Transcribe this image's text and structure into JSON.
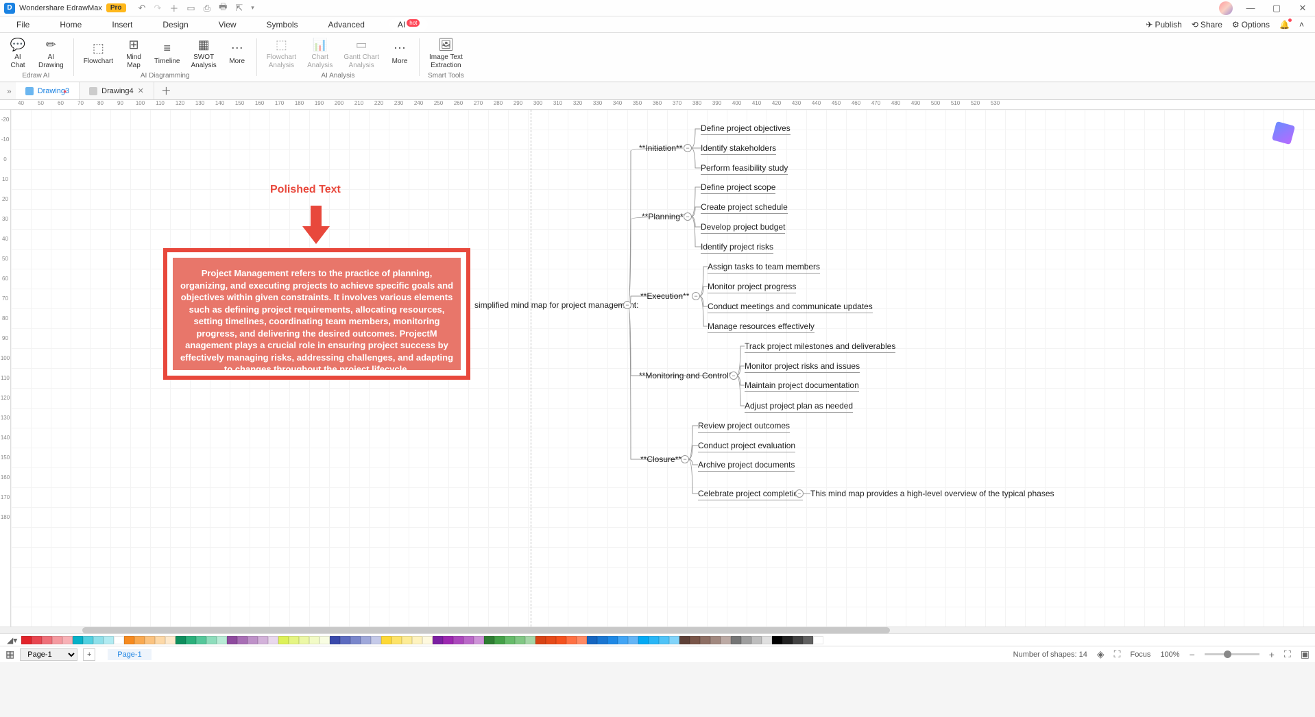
{
  "titleBar": {
    "appName": "Wondershare EdrawMax",
    "proBadge": "Pro"
  },
  "menu": {
    "items": [
      "File",
      "Home",
      "Insert",
      "Design",
      "View",
      "Symbols",
      "Advanced"
    ],
    "aiTab": "AI",
    "hotBadge": "hot",
    "right": {
      "publish": "Publish",
      "share": "Share",
      "options": "Options"
    }
  },
  "ribbon": {
    "group1": {
      "label": "Edraw AI",
      "aiChat": "AI\nChat",
      "aiDrawing": "AI\nDrawing"
    },
    "group2": {
      "label": "AI Diagramming",
      "flowchart": "Flowchart",
      "mindmap": "Mind\nMap",
      "timeline": "Timeline",
      "swot": "SWOT\nAnalysis",
      "more": "More"
    },
    "group3": {
      "label": "AI Analysis",
      "flowAnalysis": "Flowchart\nAnalysis",
      "chartAnalysis": "Chart\nAnalysis",
      "gantt": "Gantt Chart\nAnalysis",
      "more": "More"
    },
    "group4": {
      "label": "Smart Tools",
      "imgText": "Image Text\nExtraction"
    }
  },
  "docTabs": {
    "tab1": "Drawing3",
    "tab2": "Drawing4"
  },
  "canvas": {
    "polishTitle": "Polished Text",
    "paragraph": "Project Management refers to the practice of planning, organizing, and executing projects to achieve specific goals and objectives within given constraints. It involves various elements such as defining project requirements, allocating resources, setting timelines, coordinating team members, monitoring progress, and delivering the desired outcomes. ProjectM anagement plays a crucial role in ensuring project success by effectively managing risks, addressing challenges, and adapting to changes throughout the project lifecycle.",
    "root": "simplified mind map for project management:",
    "branches": {
      "initiation": "**Initiation**",
      "planning": "**Planning**",
      "execution": "**Execution**",
      "monitoring": "**Monitoring and Control**",
      "closure": "**Closure**"
    },
    "leaves": {
      "i1": "Define project objectives",
      "i2": "Identify stakeholders",
      "i3": "Perform feasibility study",
      "p1": "Define project scope",
      "p2": "Create project schedule",
      "p3": "Develop project budget",
      "p4": "Identify project risks",
      "e1": "Assign tasks to team members",
      "e2": "Monitor project progress",
      "e3": "Conduct meetings and communicate updates",
      "e4": "Manage resources effectively",
      "m1": "Track project milestones and deliverables",
      "m2": "Monitor project risks and issues",
      "m3": "Maintain project documentation",
      "m4": "Adjust project plan as needed",
      "c1": "Review project outcomes",
      "c2": "Conduct project evaluation",
      "c3": "Archive project documents",
      "c4": "Celebrate project completion",
      "overview": "This mind map provides a high-level overview of the typical phases"
    }
  },
  "hRuler": [
    "40",
    "50",
    "60",
    "70",
    "80",
    "90",
    "100",
    "110",
    "120",
    "130",
    "140",
    "150",
    "160",
    "170",
    "180",
    "190",
    "200",
    "210",
    "220",
    "230",
    "240",
    "250",
    "260",
    "270",
    "280",
    "290",
    "300",
    "310",
    "320",
    "330",
    "340",
    "350",
    "360",
    "370",
    "380",
    "390",
    "400",
    "410",
    "420",
    "430",
    "440",
    "450",
    "460",
    "470",
    "480",
    "490",
    "500",
    "510",
    "520",
    "530"
  ],
  "vRuler": [
    "-20",
    "-10",
    "0",
    "10",
    "20",
    "30",
    "40",
    "50",
    "60",
    "70",
    "80",
    "90",
    "100",
    "110",
    "120",
    "130",
    "140",
    "150",
    "160",
    "170",
    "180"
  ],
  "status": {
    "pageSel": "Page-1",
    "pageTab": "Page-1",
    "shapes": "Number of shapes: 14",
    "focus": "Focus",
    "zoom": "100%"
  },
  "colors": [
    "#e2232a",
    "#e84650",
    "#ef7079",
    "#f59aa0",
    "#f8b1b6",
    "#06b1c8",
    "#52d0e0",
    "#8fe0ea",
    "#b2ebf2",
    "#ffffff",
    "#f68a1f",
    "#f9a950",
    "#fbc380",
    "#fdd9a8",
    "#fee9cc",
    "#0e8e5d",
    "#2bb07b",
    "#55c79a",
    "#8eddbc",
    "#b8ebd6",
    "#8e4a9e",
    "#a86eb5",
    "#be91c8",
    "#d3b2da",
    "#e9d8ed",
    "#ddf157",
    "#e5f582",
    "#ecf8a6",
    "#f2fbc6",
    "#f8fde2",
    "#3949ab",
    "#5c6bc0",
    "#7986cb",
    "#9fa8da",
    "#c5cae9",
    "#fdd835",
    "#fde368",
    "#fdec96",
    "#feF3bf",
    "#fef9df",
    "#7b1fa2",
    "#9c27b0",
    "#ab47bc",
    "#ba68c8",
    "#ce93d8",
    "#2e7d32",
    "#43a047",
    "#66bb6a",
    "#81c784",
    "#a5d6a7",
    "#d84315",
    "#e64a19",
    "#f4511e",
    "#ff7043",
    "#ff8a65",
    "#1565c0",
    "#1976d2",
    "#1e88e5",
    "#42a5f5",
    "#64b5f6",
    "#03a9f4",
    "#29b6f6",
    "#4fc3f7",
    "#81d4fa",
    "#5d4037",
    "#795548",
    "#8d6e63",
    "#a1887f",
    "#bcaaa4",
    "#757575",
    "#9e9e9e",
    "#bdbdbd",
    "#e0e0e0",
    "#000000",
    "#212121",
    "#424242",
    "#616161",
    "#ffffff"
  ]
}
